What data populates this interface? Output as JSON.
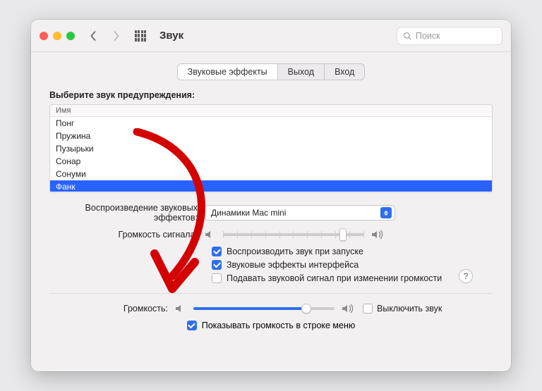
{
  "titlebar": {
    "title": "Звук",
    "search_placeholder": "Поиск"
  },
  "tabs": [
    {
      "label": "Звуковые эффекты",
      "active": true
    },
    {
      "label": "Выход",
      "active": false
    },
    {
      "label": "Вход",
      "active": false
    }
  ],
  "alerts": {
    "section_label": "Выберите звук предупреждения:",
    "column_header": "Имя",
    "items": [
      "Понг",
      "Пружина",
      "Пузырьки",
      "Сонар",
      "Сонуми",
      "Фанк"
    ],
    "selected_index": 5
  },
  "playback": {
    "device_label": "Воспроизведение звуковых эффектов:",
    "device_value": "Динамики Mac mini",
    "volume_label": "Громкость сигнала:",
    "volume_percent": 85
  },
  "options": {
    "play_on_startup": {
      "label": "Воспроизводить звук при запуске",
      "checked": true
    },
    "ui_effects": {
      "label": "Звуковые эффекты интерфейса",
      "checked": true
    },
    "feedback_volume": {
      "label": "Подавать звуковой сигнал при изменении громкости",
      "checked": false
    }
  },
  "output": {
    "volume_label": "Громкость:",
    "volume_percent": 80,
    "mute_label": "Выключить звук",
    "mute_checked": false
  },
  "menu_bar": {
    "label": "Показывать громкость в строке меню",
    "checked": true
  },
  "help_symbol": "?",
  "colors": {
    "accent": "#2f6fed",
    "selection": "#2962ff",
    "annotation": "#d40000"
  }
}
